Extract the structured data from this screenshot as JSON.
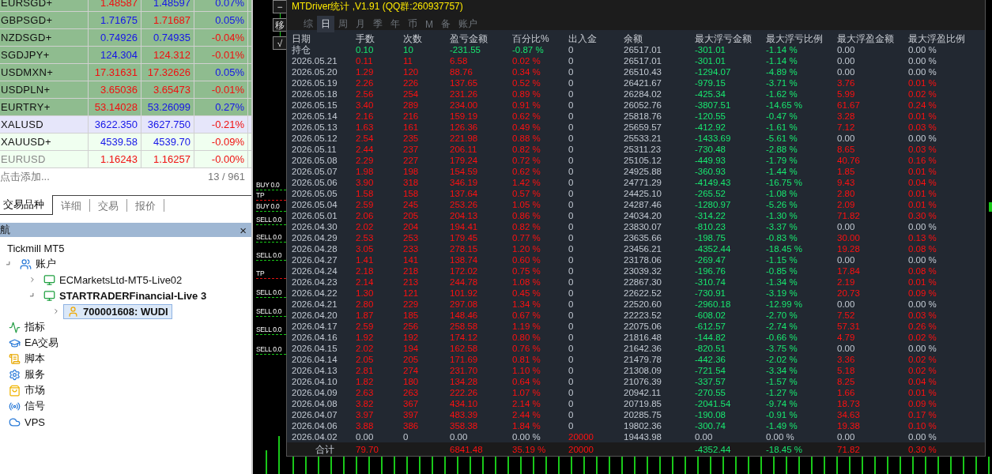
{
  "market_watch": {
    "rows": [
      {
        "symbol": "EURSGD+",
        "bid": "1.48587",
        "ask": "1.48597",
        "change": "0.07%",
        "bid_up": false,
        "ask_up": true,
        "change_up": true,
        "color": "#8fbc8f",
        "greyed": false
      },
      {
        "symbol": "GBPSGD+",
        "bid": "1.71675",
        "ask": "1.71687",
        "change": "0.05%",
        "bid_up": true,
        "ask_up": false,
        "change_up": true,
        "color": "#8fbc8f",
        "greyed": false
      },
      {
        "symbol": "NZDSGD+",
        "bid": "0.74926",
        "ask": "0.74935",
        "change": "-0.04%",
        "bid_up": true,
        "ask_up": true,
        "change_up": false,
        "color": "#8fbc8f",
        "greyed": false
      },
      {
        "symbol": "SGDJPY+",
        "bid": "124.304",
        "ask": "124.312",
        "change": "-0.01%",
        "bid_up": true,
        "ask_up": false,
        "change_up": false,
        "color": "#8fbc8f",
        "greyed": false
      },
      {
        "symbol": "USDMXN+",
        "bid": "17.31631",
        "ask": "17.32626",
        "change": "0.05%",
        "bid_up": false,
        "ask_up": false,
        "change_up": true,
        "color": "#8fbc8f",
        "greyed": false
      },
      {
        "symbol": "USDPLN+",
        "bid": "3.65036",
        "ask": "3.65473",
        "change": "-0.01%",
        "bid_up": false,
        "ask_up": false,
        "change_up": false,
        "color": "#8fbc8f",
        "greyed": false
      },
      {
        "symbol": "EURTRY+",
        "bid": "53.14028",
        "ask": "53.26099",
        "change": "0.27%",
        "bid_up": false,
        "ask_up": true,
        "change_up": true,
        "color": "#8fbc8f",
        "greyed": false
      },
      {
        "symbol": "XALUSD",
        "bid": "3622.350",
        "ask": "3627.750",
        "change": "-0.21%",
        "bid_up": true,
        "ask_up": true,
        "change_up": false,
        "color": "#e6e6fa",
        "greyed": false
      },
      {
        "symbol": "XAUUSD+",
        "bid": "4539.58",
        "ask": "4539.70",
        "change": "-0.09%",
        "bid_up": true,
        "ask_up": true,
        "change_up": false,
        "color": "#f0fff0",
        "greyed": false
      },
      {
        "symbol": "EURUSD",
        "bid": "1.16243",
        "ask": "1.16257",
        "change": "-0.00%",
        "bid_up": false,
        "ask_up": false,
        "change_up": false,
        "color": "#f0fff0",
        "greyed": true
      }
    ],
    "add_hint": "点击添加...",
    "count": "13 / 961"
  },
  "tabs": [
    {
      "label": "交易品种",
      "selected": true
    },
    {
      "label": "详细",
      "selected": false
    },
    {
      "label": "交易",
      "selected": false
    },
    {
      "label": "报价",
      "selected": false
    }
  ],
  "navigator": {
    "title": "航",
    "close": "×",
    "root": "Tickmill MT5",
    "items": [
      {
        "label": "账户",
        "selected": false,
        "expanded": true,
        "children": [
          {
            "label": "ECMarketsLtd-MT5-Live02",
            "selected": false,
            "active": false,
            "expanded": false
          },
          {
            "label": "STARTRADERFinancial-Live 3",
            "selected": false,
            "active": true,
            "expanded": true,
            "children": [
              {
                "label": "700001608: WUDI",
                "selected": true,
                "active": true,
                "expanded": false
              }
            ]
          }
        ]
      },
      {
        "label": "指标",
        "selected": false
      },
      {
        "label": "EA交易",
        "selected": false
      },
      {
        "label": "脚本",
        "selected": false
      },
      {
        "label": "服务",
        "selected": false
      },
      {
        "label": "市场",
        "selected": false
      },
      {
        "label": "信号",
        "selected": false
      },
      {
        "label": "VPS",
        "selected": false
      }
    ]
  },
  "chart": {
    "buttons": [
      "−",
      "移",
      "√"
    ],
    "orders": [
      {
        "label": "BUY 0.0",
        "kind": "buy"
      },
      {
        "label": "TP",
        "kind": "tp"
      },
      {
        "label": "BUY 0.0",
        "kind": "buy"
      },
      {
        "label": "SELL 0.0",
        "kind": "sell"
      },
      {
        "label": "SELL 0.0",
        "kind": "sell"
      },
      {
        "label": "SELL 0.0",
        "kind": "sell"
      },
      {
        "label": "TP",
        "kind": "tp"
      },
      {
        "label": "SELL 0.0",
        "kind": "sell"
      },
      {
        "label": "SELL 0.0",
        "kind": "sell"
      },
      {
        "label": "SELL 0.0",
        "kind": "sell"
      },
      {
        "label": "SELL 0.0",
        "kind": "sell"
      }
    ]
  },
  "stats": {
    "title": "MTDriver统计 ,V1.91 (QQ群:260937757)",
    "tabs": [
      {
        "label": "综",
        "selected": false
      },
      {
        "label": "日",
        "selected": true
      },
      {
        "label": "周",
        "selected": false
      },
      {
        "label": "月",
        "selected": false
      },
      {
        "label": "季",
        "selected": false
      },
      {
        "label": "年",
        "selected": false
      },
      {
        "label": "币",
        "selected": false
      },
      {
        "label": "M",
        "selected": false
      },
      {
        "label": "备",
        "selected": false
      },
      {
        "label": "账户",
        "selected": false
      }
    ],
    "columns": [
      "日期",
      "手数",
      "次数",
      "盈亏金额",
      "百分比%",
      "出入金",
      "余额",
      "最大浮亏金额",
      "最大浮亏比例",
      "最大浮盈金额",
      "最大浮盈比例"
    ],
    "rows": [
      {
        "kind": "position",
        "float_profit": false,
        "cells": [
          "持仓",
          "0.10",
          "10",
          "-231.55",
          "-0.87 %",
          "0",
          "26517.01",
          "-301.01",
          "-1.14 %",
          "0.00",
          "0.00 %"
        ]
      },
      {
        "kind": "day",
        "float_profit": false,
        "cells": [
          "2026.05.21",
          "0.11",
          "11",
          "6.58",
          "0.02 %",
          "0",
          "26517.01",
          "-301.01",
          "-1.14 %",
          "0.00",
          "0.00 %"
        ]
      },
      {
        "kind": "day",
        "float_profit": false,
        "cells": [
          "2026.05.20",
          "1.29",
          "120",
          "88.76",
          "0.34 %",
          "0",
          "26510.43",
          "-1294.07",
          "-4.89 %",
          "0.00",
          "0.00 %"
        ]
      },
      {
        "kind": "day",
        "float_profit": true,
        "cells": [
          "2026.05.19",
          "2.26",
          "226",
          "137.65",
          "0.52 %",
          "0",
          "26421.67",
          "-979.15",
          "-3.71 %",
          "3.76",
          "0.01 %"
        ]
      },
      {
        "kind": "day",
        "float_profit": true,
        "cells": [
          "2026.05.18",
          "2.56",
          "254",
          "231.26",
          "0.89 %",
          "0",
          "26284.02",
          "-425.34",
          "-1.62 %",
          "5.99",
          "0.02 %"
        ]
      },
      {
        "kind": "day",
        "float_profit": true,
        "cells": [
          "2026.05.15",
          "3.40",
          "289",
          "234.00",
          "0.91 %",
          "0",
          "26052.76",
          "-3807.51",
          "-14.65 %",
          "61.67",
          "0.24 %"
        ]
      },
      {
        "kind": "day",
        "float_profit": true,
        "cells": [
          "2026.05.14",
          "2.16",
          "216",
          "159.19",
          "0.62 %",
          "0",
          "25818.76",
          "-120.55",
          "-0.47 %",
          "3.28",
          "0.01 %"
        ]
      },
      {
        "kind": "day",
        "float_profit": true,
        "cells": [
          "2026.05.13",
          "1.63",
          "161",
          "126.36",
          "0.49 %",
          "0",
          "25659.57",
          "-412.92",
          "-1.61 %",
          "7.12",
          "0.03 %"
        ]
      },
      {
        "kind": "day",
        "float_profit": false,
        "cells": [
          "2026.05.12",
          "2.54",
          "235",
          "221.98",
          "0.88 %",
          "0",
          "25533.21",
          "-1433.69",
          "-5.61 %",
          "0.00",
          "0.00 %"
        ]
      },
      {
        "kind": "day",
        "float_profit": true,
        "cells": [
          "2026.05.11",
          "2.44",
          "237",
          "206.11",
          "0.82 %",
          "0",
          "25311.23",
          "-730.48",
          "-2.88 %",
          "8.65",
          "0.03 %"
        ]
      },
      {
        "kind": "day",
        "float_profit": true,
        "cells": [
          "2026.05.08",
          "2.29",
          "227",
          "179.24",
          "0.72 %",
          "0",
          "25105.12",
          "-449.93",
          "-1.79 %",
          "40.76",
          "0.16 %"
        ]
      },
      {
        "kind": "day",
        "float_profit": true,
        "cells": [
          "2026.05.07",
          "1.98",
          "198",
          "154.59",
          "0.62 %",
          "0",
          "24925.88",
          "-360.93",
          "-1.44 %",
          "1.85",
          "0.01 %"
        ]
      },
      {
        "kind": "day",
        "float_profit": true,
        "cells": [
          "2026.05.06",
          "3.90",
          "318",
          "346.19",
          "1.42 %",
          "0",
          "24771.29",
          "-4149.43",
          "-16.75 %",
          "9.43",
          "0.04 %"
        ]
      },
      {
        "kind": "day",
        "float_profit": true,
        "cells": [
          "2026.05.05",
          "1.58",
          "158",
          "137.64",
          "0.57 %",
          "0",
          "24425.10",
          "-265.52",
          "-1.08 %",
          "2.80",
          "0.01 %"
        ]
      },
      {
        "kind": "day",
        "float_profit": true,
        "cells": [
          "2026.05.04",
          "2.59",
          "245",
          "253.26",
          "1.05 %",
          "0",
          "24287.46",
          "-1280.97",
          "-5.26 %",
          "2.09",
          "0.01 %"
        ]
      },
      {
        "kind": "day",
        "float_profit": true,
        "cells": [
          "2026.05.01",
          "2.06",
          "205",
          "204.13",
          "0.86 %",
          "0",
          "24034.20",
          "-314.22",
          "-1.30 %",
          "71.82",
          "0.30 %"
        ]
      },
      {
        "kind": "day",
        "float_profit": false,
        "cells": [
          "2026.04.30",
          "2.02",
          "204",
          "194.41",
          "0.82 %",
          "0",
          "23830.07",
          "-810.23",
          "-3.37 %",
          "0.00",
          "0.00 %"
        ]
      },
      {
        "kind": "day",
        "float_profit": true,
        "cells": [
          "2026.04.29",
          "2.53",
          "253",
          "179.45",
          "0.77 %",
          "0",
          "23635.66",
          "-198.75",
          "-0.83 %",
          "30.00",
          "0.13 %"
        ]
      },
      {
        "kind": "day",
        "float_profit": true,
        "cells": [
          "2026.04.28",
          "3.05",
          "233",
          "278.15",
          "1.20 %",
          "0",
          "23456.21",
          "-4352.44",
          "-18.45 %",
          "19.28",
          "0.08 %"
        ]
      },
      {
        "kind": "day",
        "float_profit": false,
        "cells": [
          "2026.04.27",
          "1.41",
          "141",
          "138.74",
          "0.60 %",
          "0",
          "23178.06",
          "-269.47",
          "-1.15 %",
          "0.00",
          "0.00 %"
        ]
      },
      {
        "kind": "day",
        "float_profit": true,
        "cells": [
          "2026.04.24",
          "2.18",
          "218",
          "172.02",
          "0.75 %",
          "0",
          "23039.32",
          "-196.76",
          "-0.85 %",
          "17.84",
          "0.08 %"
        ]
      },
      {
        "kind": "day",
        "float_profit": true,
        "cells": [
          "2026.04.23",
          "2.14",
          "213",
          "244.78",
          "1.08 %",
          "0",
          "22867.30",
          "-310.74",
          "-1.34 %",
          "2.19",
          "0.01 %"
        ]
      },
      {
        "kind": "day",
        "float_profit": true,
        "cells": [
          "2026.04.22",
          "1.30",
          "121",
          "101.92",
          "0.45 %",
          "0",
          "22622.52",
          "-730.91",
          "-3.19 %",
          "20.73",
          "0.09 %"
        ]
      },
      {
        "kind": "day",
        "float_profit": false,
        "cells": [
          "2026.04.21",
          "2.80",
          "229",
          "297.08",
          "1.34 %",
          "0",
          "22520.60",
          "-2960.18",
          "-12.99 %",
          "0.00",
          "0.00 %"
        ]
      },
      {
        "kind": "day",
        "float_profit": true,
        "cells": [
          "2026.04.20",
          "1.87",
          "185",
          "148.46",
          "0.67 %",
          "0",
          "22223.52",
          "-608.02",
          "-2.70 %",
          "7.52",
          "0.03 %"
        ]
      },
      {
        "kind": "day",
        "float_profit": true,
        "cells": [
          "2026.04.17",
          "2.59",
          "256",
          "258.58",
          "1.19 %",
          "0",
          "22075.06",
          "-612.57",
          "-2.74 %",
          "57.31",
          "0.26 %"
        ]
      },
      {
        "kind": "day",
        "float_profit": true,
        "cells": [
          "2026.04.16",
          "1.92",
          "192",
          "174.12",
          "0.80 %",
          "0",
          "21816.48",
          "-144.82",
          "-0.66 %",
          "4.79",
          "0.02 %"
        ]
      },
      {
        "kind": "day",
        "float_profit": false,
        "cells": [
          "2026.04.15",
          "2.02",
          "194",
          "162.58",
          "0.76 %",
          "0",
          "21642.36",
          "-820.51",
          "-3.75 %",
          "0.00",
          "0.00 %"
        ]
      },
      {
        "kind": "day",
        "float_profit": true,
        "cells": [
          "2026.04.14",
          "2.05",
          "205",
          "171.69",
          "0.81 %",
          "0",
          "21479.78",
          "-442.36",
          "-2.02 %",
          "3.36",
          "0.02 %"
        ]
      },
      {
        "kind": "day",
        "float_profit": true,
        "cells": [
          "2026.04.13",
          "2.81",
          "274",
          "231.70",
          "1.10 %",
          "0",
          "21308.09",
          "-721.54",
          "-3.34 %",
          "5.18",
          "0.02 %"
        ]
      },
      {
        "kind": "day",
        "float_profit": true,
        "cells": [
          "2026.04.10",
          "1.82",
          "180",
          "134.28",
          "0.64 %",
          "0",
          "21076.39",
          "-337.57",
          "-1.57 %",
          "8.25",
          "0.04 %"
        ]
      },
      {
        "kind": "day",
        "float_profit": true,
        "cells": [
          "2026.04.09",
          "2.63",
          "263",
          "222.26",
          "1.07 %",
          "0",
          "20942.11",
          "-270.55",
          "-1.27 %",
          "1.66",
          "0.01 %"
        ]
      },
      {
        "kind": "day",
        "float_profit": true,
        "cells": [
          "2026.04.08",
          "3.82",
          "367",
          "434.10",
          "2.14 %",
          "0",
          "20719.85",
          "-2041.54",
          "-9.74 %",
          "18.73",
          "0.09 %"
        ]
      },
      {
        "kind": "day",
        "float_profit": true,
        "cells": [
          "2026.04.07",
          "3.97",
          "397",
          "483.39",
          "2.44 %",
          "0",
          "20285.75",
          "-190.08",
          "-0.91 %",
          "34.63",
          "0.17 %"
        ]
      },
      {
        "kind": "day",
        "float_profit": true,
        "cells": [
          "2026.04.06",
          "3.88",
          "386",
          "358.38",
          "1.84 %",
          "0",
          "19802.36",
          "-300.74",
          "-1.49 %",
          "19.38",
          "0.10 %"
        ]
      },
      {
        "kind": "deposit",
        "float_profit": false,
        "cells": [
          "2026.04.02",
          "0.00",
          "0",
          "0.00",
          "0.00 %",
          "20000",
          "19443.98",
          "0.00",
          "0.00 %",
          "0.00",
          "0.00 %"
        ]
      }
    ],
    "total": {
      "cells": [
        "合计",
        "79.70",
        null,
        "6841.48",
        "35.19 %",
        "20000",
        null,
        "-4352.44",
        "-18.45 %",
        "71.82",
        "0.30 %"
      ]
    }
  }
}
